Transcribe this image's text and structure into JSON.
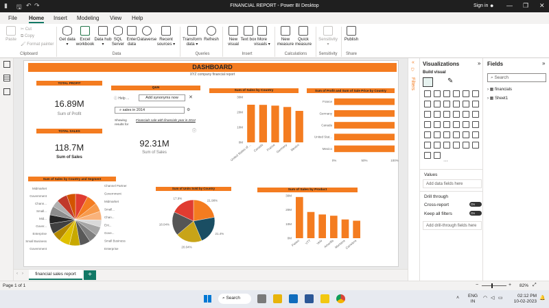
{
  "window": {
    "title": "FINANCIAL REPORT - Power BI Desktop",
    "sign_in": "Sign in"
  },
  "menu": {
    "tabs": [
      "File",
      "Home",
      "Insert",
      "Modeling",
      "View",
      "Help"
    ],
    "active": "Home"
  },
  "ribbon": {
    "paste": "Paste",
    "cut": "Cut",
    "copy": "Copy",
    "format_painter": "Format painter",
    "clipboard_group": "Clipboard",
    "get_data": "Get data ▾",
    "excel_workbook": "Excel workbook",
    "data_hub": "Data hub ▾",
    "sql_server": "SQL Server",
    "enter_data": "Enter data",
    "dataverse": "Dataverse",
    "recent_sources": "Recent sources ▾",
    "data_group": "Data",
    "transform_data": "Transform data ▾",
    "refresh": "Refresh",
    "queries_group": "Queries",
    "new_visual": "New visual",
    "text_box": "Text box",
    "more_visuals": "More visuals ▾",
    "insert_group": "Insert",
    "new_measure": "New measure",
    "quick_measure": "Quick measure",
    "calculations_group": "Calculations",
    "sensitivity": "Sensitivity ▾",
    "sensitivity_group": "Sensitivity",
    "publish": "Publish",
    "share_group": "Share"
  },
  "report": {
    "header": "DASHBOARD",
    "subheader": "XYZ company financial report",
    "total_profit_title": "TOTAL PROFIT",
    "total_profit_value": "16.89M",
    "total_profit_label": "Sum of Profit",
    "total_sales_title": "TOTAL SALES",
    "total_sales_value": "118.7M",
    "total_sales_label": "Sum of  Sales",
    "qna_title": "Q&N",
    "qna_help": "Help ...",
    "qna_synonyms": "Add synonyms now",
    "qna_query": "sales in 2014",
    "qna_showing": "Showing results for",
    "qna_interpret": "Financials sale with financials year in 2014",
    "qna_value": "92.31M",
    "qna_value_label": "Sum of  Sales"
  },
  "chart_data": [
    {
      "type": "bar",
      "title": "Sum of  Sales by Country",
      "categories": [
        "United States of ...",
        "Canada",
        "France",
        "Germany",
        "Mexico"
      ],
      "values": [
        25.0,
        24.9,
        24.4,
        23.5,
        20.9
      ],
      "y_ticks": [
        "0M",
        "10M",
        "20M",
        "30M"
      ],
      "ylim": [
        0,
        30
      ],
      "color": "#f47c20"
    },
    {
      "type": "bar",
      "orientation": "horizontal",
      "title": "Sum of Profit and Sum of Sale Price by Country",
      "categories": [
        "France",
        "Germany",
        "Canada",
        "United Stat...",
        "Mexico"
      ],
      "values": [
        100,
        100,
        100,
        100,
        100
      ],
      "x_ticks": [
        "0%",
        "50%",
        "100%"
      ],
      "xlim": [
        0,
        100
      ],
      "color": "#f47c20"
    },
    {
      "type": "pie",
      "title": "Sum of  Sales by Country and Segment",
      "labels_left": [
        "Midmarket",
        "Government",
        "Chann...",
        "Small...",
        "Mid...",
        "Gover...",
        "Enterprise",
        "Small Business",
        "Government"
      ],
      "labels_right": [
        "Channel Partners",
        "Government",
        "Midmarket",
        "Small...",
        "Chan...",
        "Ent...",
        "Gove...",
        "Small Business",
        "Enterprise"
      ],
      "slices": [
        {
          "value": 7,
          "color": "#e03c31"
        },
        {
          "value": 6,
          "color": "#f47c20"
        },
        {
          "value": 5,
          "color": "#f79a4b"
        },
        {
          "value": 5,
          "color": "#f9b27a"
        },
        {
          "value": 4,
          "color": "#d9d9d9"
        },
        {
          "value": 5,
          "color": "#a6a6a6"
        },
        {
          "value": 5,
          "color": "#7f7f7f"
        },
        {
          "value": 6,
          "color": "#595959"
        },
        {
          "value": 6,
          "color": "#c8a900"
        },
        {
          "value": 6,
          "color": "#e0c000"
        },
        {
          "value": 5,
          "color": "#b58a00"
        },
        {
          "value": 6,
          "color": "#404040"
        },
        {
          "value": 5,
          "color": "#262626"
        },
        {
          "value": 5,
          "color": "#8c8c8c"
        },
        {
          "value": 4,
          "color": "#b0b0b0"
        },
        {
          "value": 6,
          "color": "#c0392b"
        },
        {
          "value": 5,
          "color": "#d35400"
        }
      ]
    },
    {
      "type": "pie",
      "title": "Sum of Units Sold by Country",
      "slices": [
        {
          "label": "21.98%",
          "value": 21.98,
          "color": "#f47c20"
        },
        {
          "label": "21.4%",
          "value": 21.4,
          "color": "#1a4e63"
        },
        {
          "label": "20.04%",
          "value": 20.04,
          "color": "#c8a418"
        },
        {
          "label": "18.04%",
          "value": 18.04,
          "color": "#555555"
        },
        {
          "label": "17.9%",
          "value": 17.9,
          "color": "#e03c31"
        }
      ]
    },
    {
      "type": "bar",
      "title": "Sum of  Sales by Product",
      "categories": [
        "Paseo",
        "VTT",
        "Velo",
        "Amarilla",
        "Montana",
        "Carretera"
      ],
      "values": [
        33,
        21,
        19,
        18,
        15,
        14
      ],
      "y_ticks": [
        "0M",
        "10M",
        "20M",
        "30M"
      ],
      "ylim": [
        0,
        34
      ],
      "color": "#f47c20"
    }
  ],
  "panels": {
    "filters": "Filters",
    "visualizations": "Visualizations",
    "build_visual": "Build visual",
    "more": "···",
    "values": "Values",
    "add_data_fields": "Add data fields here",
    "drill_through": "Drill through",
    "cross_report": "Cross-report",
    "keep_all_filters": "Keep all filters",
    "toggle_on": "On",
    "add_drill": "Add drill-through fields here",
    "fields": "Fields",
    "search_placeholder": "Search",
    "field_items": [
      "financials",
      "Sheet1"
    ]
  },
  "page_tabs": {
    "tab": "financial sales report",
    "add": "+"
  },
  "status": {
    "page": "Page 1 of 1",
    "zoom": "82%"
  },
  "taskbar": {
    "search": "Search",
    "lang": "ENG",
    "region": "IN",
    "time": "02:12 PM",
    "date": "10-02-2023"
  }
}
